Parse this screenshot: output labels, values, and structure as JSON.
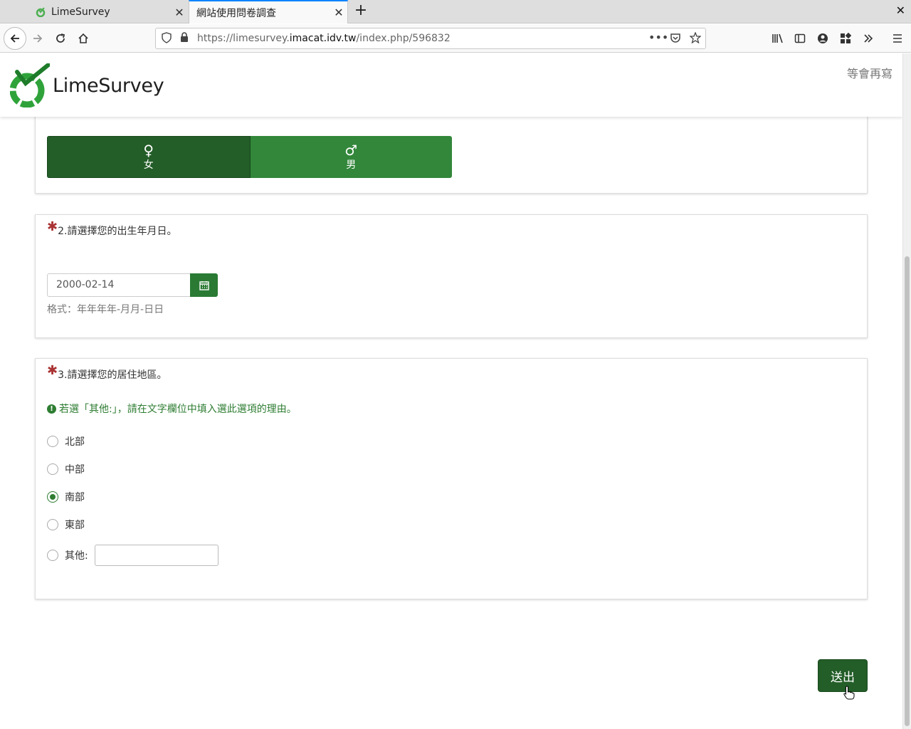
{
  "browser": {
    "tabs": [
      {
        "title": "LimeSurvey",
        "active": false
      },
      {
        "title": "網站使用問卷調查",
        "active": true
      }
    ],
    "url_prefix": "https://limesurvey.",
    "url_domain": "imacat.idv.tw",
    "url_path": "/index.php/596832"
  },
  "header": {
    "logo_text": "LimeSurvey",
    "later_link": "等會再寫"
  },
  "q1": {
    "options": [
      {
        "symbol": "♀",
        "label": "女",
        "selected": true
      },
      {
        "symbol": "♂",
        "label": "男",
        "selected": false
      }
    ]
  },
  "q2": {
    "title": "2.請選擇您的出生年月日。",
    "value": "2000-02-14",
    "format": "格式：年年年年-月月-日日"
  },
  "q3": {
    "title": "3.請選擇您的居住地區。",
    "hint": "若選「其他:」，請在文字欄位中填入選此選項的理由。",
    "options": [
      "北部",
      "中部",
      "南部",
      "東部",
      "其他:"
    ],
    "selected": "南部"
  },
  "submit_label": "送出",
  "colors": {
    "primary": "#32873a",
    "primary_dark": "#235d28",
    "required": "#aa3333"
  }
}
